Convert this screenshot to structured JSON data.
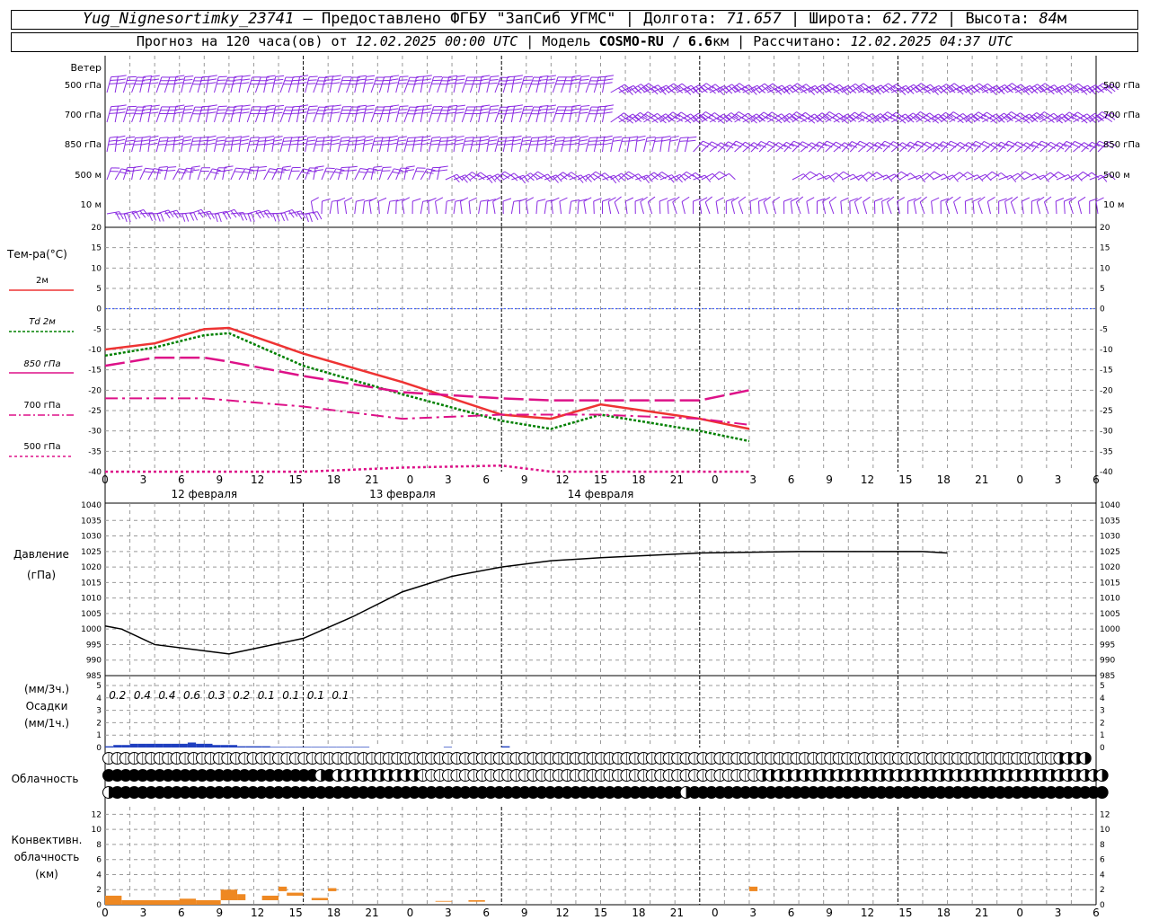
{
  "header": {
    "station": "Yug_Nignesortimky_23741",
    "dash": " — ",
    "provided_label": "Предоставлено ФГБУ \"ЗапСиб УГМС\"",
    "sep": " | ",
    "lon_label": "Долгота: ",
    "lon_value": "71.657",
    "lat_label": "Широта: ",
    "lat_value": "62.772",
    "alt_label": "Высота: ",
    "alt_value": "84",
    "alt_unit": "м",
    "forecast_prefix": "Прогноз на 120 часа(ов) от ",
    "forecast_time": "12.02.2025 00:00 UTC",
    "model_label": "Модель ",
    "model_name": "COSMO-RU / 6.6",
    "model_unit": "км",
    "calc_label": "Рассчитано: ",
    "calc_time": "12.02.2025 04:37 UTC"
  },
  "wind_panel": {
    "title": "Ветер",
    "levels": [
      "500 гПа",
      "700 гПа",
      "850 гПа",
      "500 м",
      "10 м"
    ],
    "levels_right": [
      "500 гПа",
      "700 гПа",
      "850 гПа",
      "500 м",
      "10 м"
    ],
    "color": "#8a2be2"
  },
  "labels": {
    "temp_title": "Тем-ра(°С)",
    "legend_2m": "2м",
    "legend_td": "Td  2м",
    "legend_850": "850 гПа",
    "legend_700": "700 гПа",
    "legend_500": "500 гПа",
    "pressure_title": "Давление",
    "pressure_unit": "(гПа)",
    "precip_unit3": "(мм/3ч.)",
    "precip_title": "Осадки",
    "precip_unit1": "(мм/1ч.)",
    "cloud_title": "Облачность",
    "conv_title1": "Конвективн.",
    "conv_title2": "облачность",
    "conv_unit": "(км)"
  },
  "dates": [
    "12 февраля",
    "13 февраля",
    "14 февраля"
  ],
  "x_tick_labels": [
    "0",
    "3",
    "6",
    "9",
    "12",
    "15",
    "18",
    "21",
    "0",
    "3",
    "6",
    "9",
    "12",
    "15",
    "18",
    "21",
    "0",
    "3",
    "6",
    "9",
    "12",
    "15",
    "18",
    "21",
    "0",
    "3",
    "6"
  ],
  "precip_3h_labels": [
    "0.2",
    "0.4",
    "0.4",
    "0.6",
    "0.3",
    "0.2",
    "0.1",
    "0.1",
    "0.1",
    "0.1"
  ],
  "chart_data": [
    {
      "type": "line",
      "name": "temperature",
      "x_hours": [
        0,
        6,
        12,
        15,
        24,
        36,
        48,
        54,
        60,
        72,
        78
      ],
      "ylim": [
        -40,
        20
      ],
      "yticks": [
        20,
        15,
        10,
        5,
        0,
        -5,
        -10,
        -15,
        -20,
        -25,
        -30,
        -35,
        -40
      ],
      "series": [
        {
          "name": "2м",
          "color": "#ee3333",
          "values": [
            -10,
            -8.5,
            -5,
            -4.7,
            -11,
            -18,
            -26,
            -27,
            -23.5,
            -27,
            -29.5
          ]
        },
        {
          "name": "Td  2м",
          "color": "#008000",
          "values": [
            -11.5,
            -9.5,
            -6.5,
            -6,
            -14,
            -21,
            -27.5,
            -29.5,
            -26,
            -30,
            -32.5
          ]
        },
        {
          "name": "850 гПа",
          "color": "#dd1188",
          "values": [
            -14,
            -12,
            -12,
            -13,
            -16.5,
            -20.5,
            -22,
            -22.5,
            -22.5,
            -22.5,
            -20
          ]
        },
        {
          "name": "700 гПа",
          "color": "#dd1188",
          "values": [
            -22,
            -22,
            -22,
            -22.5,
            -24,
            -27,
            -26,
            -26,
            -26,
            -27,
            -28.5
          ]
        },
        {
          "name": "500 гПа",
          "color": "#dd1188",
          "values": [
            -40,
            -40,
            -40,
            -40,
            -40,
            -39,
            -38.5,
            -40,
            -40,
            -40,
            -40
          ]
        }
      ]
    },
    {
      "type": "line",
      "name": "pressure",
      "x_hours": [
        0,
        2,
        6,
        12,
        15,
        24,
        30,
        36,
        42,
        48,
        54,
        60,
        72,
        84,
        96,
        99,
        102
      ],
      "ylim": [
        985,
        1040
      ],
      "yticks": [
        1040,
        1035,
        1030,
        1025,
        1020,
        1015,
        1010,
        1005,
        1000,
        995,
        990,
        985
      ],
      "series": [
        {
          "name": "Давление",
          "color": "#000000",
          "values": [
            1001,
            1000,
            995,
            993,
            992,
            997,
            1004,
            1012,
            1017,
            1020,
            1022,
            1023,
            1024.5,
            1025,
            1025,
            1025,
            1024.5
          ]
        }
      ]
    },
    {
      "type": "bar",
      "name": "precipitation",
      "ylim": [
        0,
        5
      ],
      "yticks": [
        5,
        4,
        3,
        2,
        1,
        0
      ],
      "x_hours": [
        1,
        2,
        3,
        4,
        5,
        6,
        7,
        8,
        9,
        10,
        11,
        12,
        13,
        14,
        15,
        16,
        17,
        18,
        19,
        20,
        21,
        22,
        23,
        24,
        25,
        26,
        27,
        28,
        29,
        30,
        31,
        32,
        33,
        34,
        35,
        36,
        37,
        38,
        39,
        40,
        41,
        42,
        43,
        44,
        45,
        46,
        47,
        48,
        49,
        50,
        51,
        52,
        53,
        54,
        55,
        56,
        57,
        58,
        59,
        60,
        61,
        62,
        63,
        64,
        65,
        66,
        67,
        68,
        69,
        70,
        71,
        72,
        73,
        74,
        75,
        76,
        77,
        78,
        79,
        80,
        81,
        82,
        83,
        84,
        85,
        86,
        87,
        88,
        89,
        90,
        91,
        92,
        93,
        94,
        95,
        96,
        97,
        98,
        99,
        100,
        101,
        102,
        103,
        104,
        105,
        106,
        107,
        108,
        109,
        110,
        111,
        112,
        113,
        114,
        115,
        116,
        117,
        118,
        119,
        120
      ],
      "values": [
        0.1,
        0.2,
        0.2,
        0.3,
        0.3,
        0.3,
        0.3,
        0.3,
        0.3,
        0.3,
        0.4,
        0.3,
        0.3,
        0.2,
        0.2,
        0.2,
        0.1,
        0.1,
        0.1,
        0.1,
        0.05,
        0.05,
        0.05,
        0.05,
        0.05,
        0.05,
        0.05,
        0.05,
        0.05,
        0.05,
        0.05,
        0.05,
        0,
        0,
        0,
        0,
        0,
        0,
        0,
        0,
        0,
        0.05,
        0,
        0,
        0,
        0,
        0,
        0,
        0.1,
        0,
        0,
        0,
        0,
        0,
        0,
        0,
        0,
        0,
        0,
        0,
        0,
        0,
        0,
        0,
        0,
        0,
        0,
        0,
        0,
        0,
        0,
        0,
        0,
        0,
        0,
        0,
        0,
        0,
        0,
        0,
        0,
        0,
        0,
        0,
        0,
        0,
        0,
        0,
        0,
        0,
        0,
        0,
        0,
        0,
        0,
        0,
        0,
        0,
        0,
        0,
        0,
        0,
        0,
        0,
        0,
        0,
        0,
        0,
        0,
        0,
        0,
        0,
        0,
        0,
        0,
        0,
        0,
        0,
        0,
        0
      ],
      "color": "#1f3fbf"
    },
    {
      "type": "bar",
      "name": "convective_cloud",
      "ylim": [
        0,
        13
      ],
      "yticks": [
        12,
        10,
        8,
        6,
        4,
        2,
        0
      ],
      "segments": [
        {
          "x0": 0,
          "x1": 2,
          "base": 0,
          "top": 1.2
        },
        {
          "x0": 2,
          "x1": 9,
          "base": 0,
          "top": 0.6
        },
        {
          "x0": 9,
          "x1": 11,
          "base": 0,
          "top": 0.8
        },
        {
          "x0": 11,
          "x1": 14,
          "base": 0,
          "top": 0.6
        },
        {
          "x0": 14,
          "x1": 16,
          "base": 0.6,
          "top": 2.0
        },
        {
          "x0": 16,
          "x1": 17,
          "base": 0.6,
          "top": 1.4
        },
        {
          "x0": 19,
          "x1": 21,
          "base": 0.6,
          "top": 1.2
        },
        {
          "x0": 21,
          "x1": 22,
          "base": 1.8,
          "top": 2.4
        },
        {
          "x0": 22,
          "x1": 24,
          "base": 1.2,
          "top": 1.6
        },
        {
          "x0": 25,
          "x1": 27,
          "base": 0.6,
          "top": 0.9
        },
        {
          "x0": 27,
          "x1": 28,
          "base": 1.8,
          "top": 2.2
        },
        {
          "x0": 40,
          "x1": 42,
          "base": 0.4,
          "top": 0.5
        },
        {
          "x0": 44,
          "x1": 46,
          "base": 0.4,
          "top": 0.6
        },
        {
          "x0": 78,
          "x1": 79,
          "base": 1.8,
          "top": 2.4
        }
      ],
      "color": "#ee8822"
    }
  ],
  "cloud_rows": {
    "row1": "OOOOOOOOOOOOOOOOOOOOOOOOOOOOOOOOOOOOOOOOOOOOOOOOOOOOOOOOOOOOOOOOOOOOOOOOOOOOOOOOOOOOOOOOOOOOOOOOOOOOOOOOOOOOOOOOHHHH",
    "row2": "FFFFFFFFFFFFFFFFFFFFFFFFFHFHHHHHHHHHHOOOOOOOOOOOOOOOOOOOOOOOOOOOOOOOOOOOOOOOOHHHHHHHHHHHHHHHHHHHHHHHHHHHHHHHHHHHHHHHHHHHFF",
    "row3": "HFFFFFFFFFFFFFFFFFFFFFFFFFFFFFFFFFFFFFFFFFFFFFFFFFFFFFFFFFFFFFFFFFFFHFFFFFFFFFFFFFFFFFFFFFFFFFFFFFFFFFFFFFFFFFFFFFFFFFF"
  }
}
